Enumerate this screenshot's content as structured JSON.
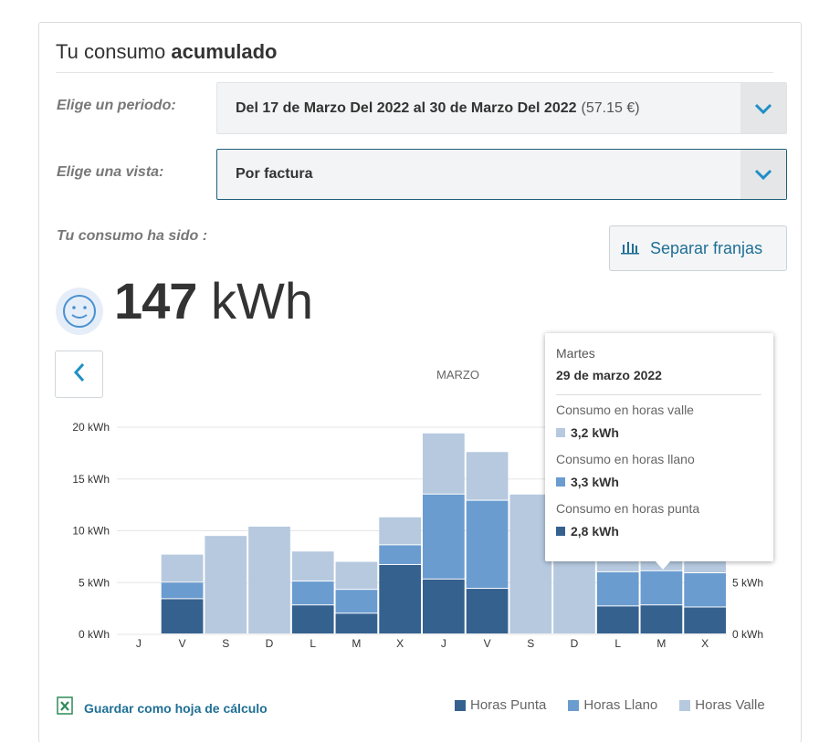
{
  "header": {
    "title_light": "Tu consumo ",
    "title_bold": "acumulado"
  },
  "filters": {
    "period_label": "Elige un periodo:",
    "period_value": "Del 17 de Marzo Del 2022 al 30 de Marzo Del 2022",
    "period_amount": "(57.15 €)",
    "view_label": "Elige una vista:",
    "view_value": "Por factura"
  },
  "summary": {
    "label": "Tu consumo ha sido :",
    "value": "147",
    "unit": "kWh",
    "split_button": "Separar franjas"
  },
  "chart_nav": {
    "month": "MARZO"
  },
  "tooltip": {
    "weekday": "Martes",
    "date": "29 de marzo 2022",
    "items": [
      {
        "label": "Consumo en horas valle",
        "value": "3,2 kWh"
      },
      {
        "label": "Consumo en horas llano",
        "value": "3,3 kWh"
      },
      {
        "label": "Consumo en horas punta",
        "value": "2,8 kWh"
      }
    ]
  },
  "footer": {
    "save_label": "Guardar como hoja de cálculo",
    "legend": [
      "Horas Punta",
      "Horas Llano",
      "Horas Valle"
    ]
  },
  "colors": {
    "punta": "#35618f",
    "llano": "#6a9cd0",
    "valle": "#b6c9df",
    "accent": "#1f6f95"
  },
  "chart_data": {
    "type": "bar",
    "stacked": true,
    "categories": [
      "J",
      "V",
      "S",
      "D",
      "L",
      "M",
      "X",
      "J",
      "V",
      "S",
      "D",
      "L",
      "M",
      "X"
    ],
    "series": [
      {
        "name": "Horas Punta",
        "values": [
          0,
          3.4,
          0,
          0,
          2.8,
          2.0,
          6.7,
          5.3,
          4.4,
          0,
          0,
          2.7,
          2.8,
          2.6
        ]
      },
      {
        "name": "Horas Llano",
        "values": [
          0,
          1.6,
          0,
          0,
          2.3,
          2.3,
          1.9,
          8.2,
          8.5,
          0,
          0,
          3.3,
          3.3,
          3.3
        ]
      },
      {
        "name": "Horas Valle",
        "values": [
          0,
          2.7,
          9.5,
          10.4,
          2.9,
          2.7,
          2.7,
          5.9,
          4.7,
          13.5,
          12.3,
          3.2,
          3.2,
          3.2
        ]
      }
    ],
    "y_ticks": [
      "0 kWh",
      "5 kWh",
      "10 kWh",
      "15 kWh",
      "20 kWh"
    ],
    "ylim": [
      0,
      20
    ],
    "grid": true
  }
}
